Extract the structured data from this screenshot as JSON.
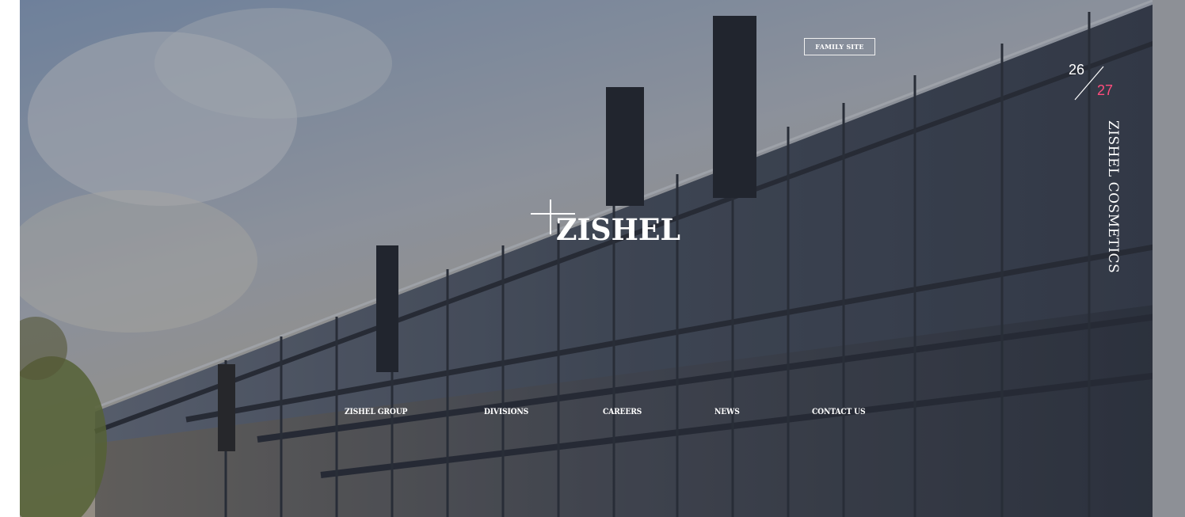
{
  "header": {
    "family_site_label": "FAMILY SITE"
  },
  "logo": {
    "wordmark": "ZISHEL"
  },
  "pager": {
    "current": "26",
    "total": "27"
  },
  "side_title": "ZISHEL COSMETICS",
  "nav": {
    "items": [
      {
        "label": "ZISHEL GROUP"
      },
      {
        "label": "DIVISIONS"
      },
      {
        "label": "CAREERS"
      },
      {
        "label": "NEWS"
      },
      {
        "label": "CONTACT US"
      }
    ]
  },
  "colors": {
    "accent": "#ff4d7d",
    "text": "#ffffff",
    "overlay": "#1c202a"
  }
}
